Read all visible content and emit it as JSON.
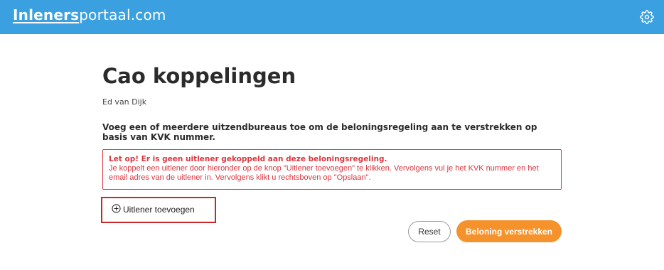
{
  "header": {
    "brand_bold": "Inleners",
    "brand_rest": "portaal.com",
    "settings_icon": "gear-icon",
    "background_color": "#3aa0e0"
  },
  "page": {
    "title": "Cao koppelingen",
    "subtitle": "Ed van Dijk",
    "intro": "Voeg een of meerdere uitzendbureaus toe om de beloningsregeling aan te verstrekken op basis van KVK nummer."
  },
  "alert": {
    "title": "Let op! Er is geen uitlener gekoppeld aan deze beloningsregeling.",
    "body": "Je koppelt een uitlener door hieronder op de knop \"Uitlener toevoegen\" te klikken. Vervolgens vul je het KVK nummer en het email adres van de uitlener in. Vervolgens klikt u rechtsboven op \"Opslaan\".",
    "color": "#d9363e"
  },
  "actions": {
    "add_label": "Uitlener toevoegen",
    "add_icon": "plus-circle-icon",
    "reset_label": "Reset",
    "primary_label": "Beloning verstrekken",
    "primary_color": "#f5922b"
  }
}
